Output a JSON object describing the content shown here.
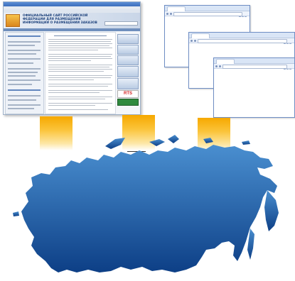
{
  "portal": {
    "site_title": "ОФИЦИАЛЬНЫЙ САЙТ РОССИЙСКОЙ ФЕДЕРАЦИИ ДЛЯ РАЗМЕЩЕНИЯ ИНФОРМАЦИИ О РАЗМЕЩЕНИИ ЗАКАЗОВ",
    "rts_label": "RTS"
  },
  "colors": {
    "map_fill_top": "#4a8fd0",
    "map_fill_bottom": "#0d3f86",
    "beam_gold": "#f6a800",
    "window_border": "#6f8ec4"
  },
  "icons": [
    "site-logo-icon",
    "russia-map-icon"
  ]
}
